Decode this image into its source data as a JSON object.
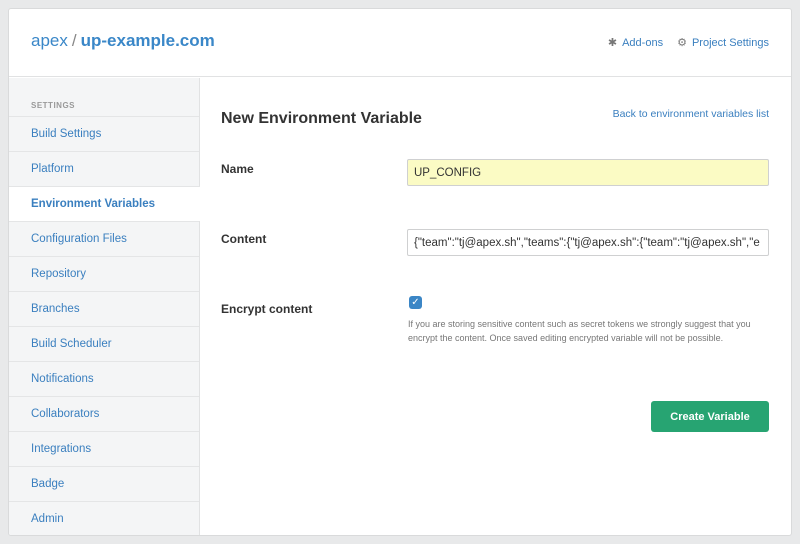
{
  "header": {
    "org": "apex",
    "separator": "/",
    "project": "up-example.com",
    "links": [
      {
        "label": "Add-ons",
        "icon": "puzzle-icon"
      },
      {
        "label": "Project Settings",
        "icon": "gear-icon"
      }
    ]
  },
  "sidebar": {
    "heading": "SETTINGS",
    "items": [
      {
        "label": "Build Settings"
      },
      {
        "label": "Platform"
      },
      {
        "label": "Environment Variables",
        "active": true
      },
      {
        "label": "Configuration Files"
      },
      {
        "label": "Repository"
      },
      {
        "label": "Branches"
      },
      {
        "label": "Build Scheduler"
      },
      {
        "label": "Notifications"
      },
      {
        "label": "Collaborators"
      },
      {
        "label": "Integrations"
      },
      {
        "label": "Badge"
      },
      {
        "label": "Admin"
      }
    ]
  },
  "main": {
    "title": "New Environment Variable",
    "back_link": "Back to environment variables list",
    "name_label": "Name",
    "name_value": "UP_CONFIG",
    "content_label": "Content",
    "content_value": "{\"team\":\"tj@apex.sh\",\"teams\":{\"tj@apex.sh\":{\"team\":\"tj@apex.sh\",\"e",
    "encrypt_label": "Encrypt content",
    "encrypt_checked": true,
    "encrypt_help": "If you are storing sensitive content such as secret tokens we strongly suggest that you encrypt the content. Once saved editing encrypted variable will not be possible.",
    "submit_label": "Create Variable"
  },
  "colors": {
    "link": "#3a7fbf",
    "button": "#27a472",
    "name_field_bg": "#fbfbc4",
    "checkbox": "#3b86c6"
  }
}
